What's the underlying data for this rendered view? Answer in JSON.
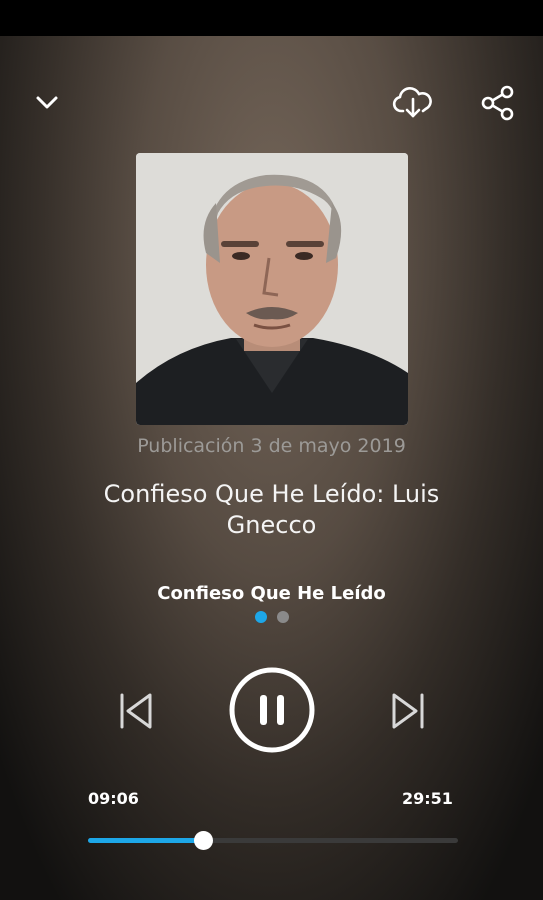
{
  "episode": {
    "published_label": "Publicación",
    "published_date": "3 de mayo 2019",
    "title": "Confieso Que He Leído: Luis Gnecco",
    "show_name": "Confieso Que He Leído"
  },
  "player": {
    "elapsed": "09:06",
    "total": "29:51",
    "progress": 0.31,
    "state": "playing",
    "page_indicator": {
      "count": 2,
      "active": 0
    }
  },
  "icons": {
    "collapse": "chevron-down-icon",
    "download": "cloud-download-icon",
    "share": "share-icon",
    "previous": "skip-previous-icon",
    "pause": "pause-icon",
    "next": "skip-next-icon"
  },
  "colors": {
    "accent": "#1da7e8",
    "text": "#ffffff",
    "muted_text": "#9c9a97"
  }
}
